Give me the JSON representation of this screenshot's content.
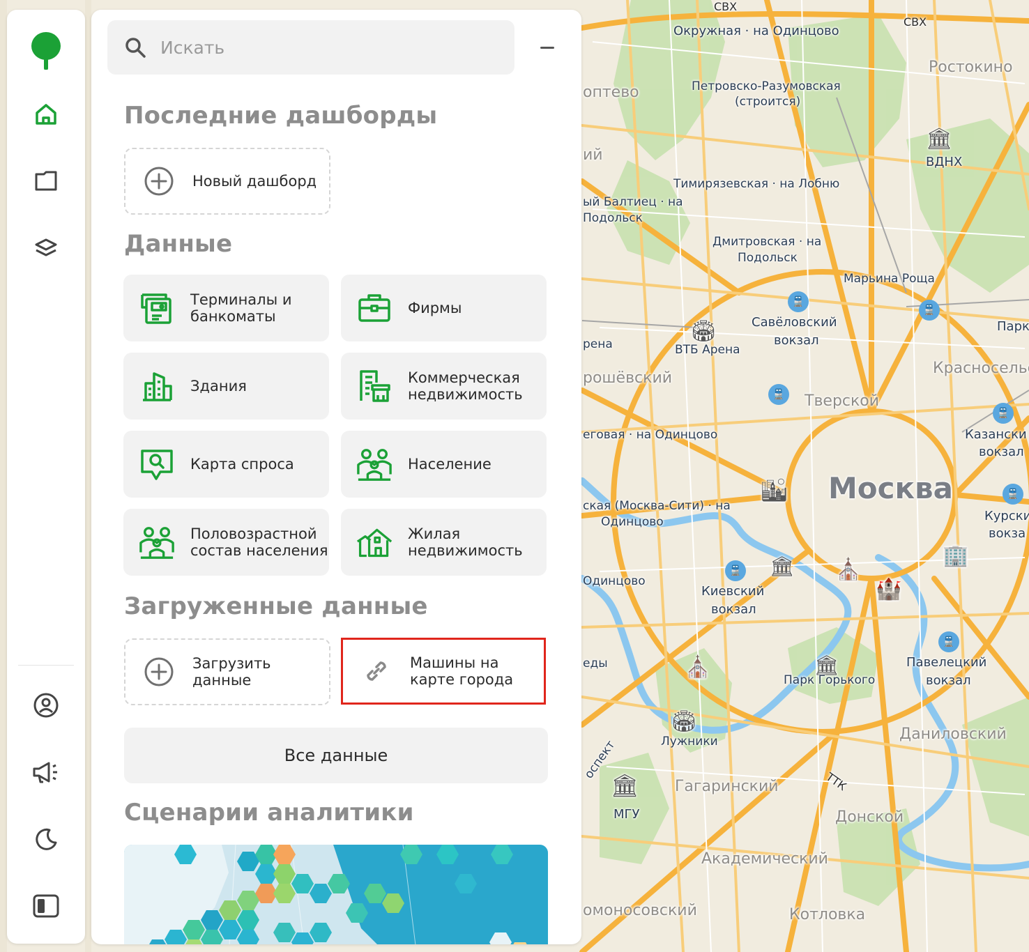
{
  "map": {
    "labels": {
      "svh_top": "СВХ",
      "svh_right": "СВХ",
      "okruzhnaya": "Окружная · на Одинцово",
      "rostokino": "Ростокино",
      "koptevo": "оптево",
      "petrovsko": "Петровско-Разумовская",
      "stroitsya": "(строится)",
      "vdnh": "ВДНХ",
      "iy": "ий",
      "timiryazevskaya": "Тимирязевская · на Лобню",
      "baltiets": "ый Балтиец · на",
      "podolsk1": "Подольск",
      "dmitrovskaya": "Дмитровская · на",
      "podolsk2": "Подольск",
      "maryina": "Марьина Роща",
      "savelovsky": "Савёловский",
      "vokzal1": "вокзал",
      "park": "Парк",
      "rena": "рена",
      "vtb": "ВТБ Арена",
      "krasnoselsky": "Красносельс",
      "roshevsky": "рошёвский",
      "tverskoy": "Тверской",
      "begovaya": "еговая · на Одинцово",
      "kazansky": "Казански",
      "vokzal2": "вокзал",
      "moskva": "Москва",
      "moskvacity": "ская (Москва-Сити) · на",
      "odintsovo1": "Одинцово",
      "kursky": "Курски",
      "vokzal3": "вокза",
      "odintsovo2": "Одинцово",
      "kievsky": "Киевский",
      "vokzal4": "вокзал",
      "edy": "еды",
      "park_gorkogo": "Парк Горького",
      "paveletsky": "Павелецкий",
      "vokzal5": "вокзал",
      "luzhniki": "Лужники",
      "danilovsky": "Даниловский",
      "prospekt": "оспект",
      "ttk": "ТТК",
      "gagarinsky": "Гагаринский",
      "mgu": "МГУ",
      "donskoy": "Донской",
      "akademichesky": "Академический",
      "lomonosovsky": "омоносовский",
      "kotlovka": "Котловка"
    }
  },
  "rail": {
    "items": [
      {
        "name": "logo",
        "icon": "tree-logo-icon"
      },
      {
        "name": "home",
        "icon": "home-icon"
      },
      {
        "name": "folder",
        "icon": "folder-icon"
      },
      {
        "name": "layers",
        "icon": "layers-icon"
      },
      {
        "name": "profile",
        "icon": "user-circle-icon"
      },
      {
        "name": "announcements",
        "icon": "megaphone-icon"
      },
      {
        "name": "theme",
        "icon": "moon-icon"
      },
      {
        "name": "sidebar",
        "icon": "sidebar-toggle-icon"
      }
    ]
  },
  "panel": {
    "search": {
      "placeholder": "Искать"
    },
    "recent_dashboards": {
      "title": "Последние дашборды",
      "new_dashboard": "Новый дашборд"
    },
    "data": {
      "title": "Данные",
      "tiles": [
        {
          "label": "Терминалы и банкоматы",
          "icon": "atm-icon"
        },
        {
          "label": "Фирмы",
          "icon": "briefcase-icon"
        },
        {
          "label": "Здания",
          "icon": "buildings-icon"
        },
        {
          "label": "Коммерческая недвижимость",
          "icon": "commercial-property-icon"
        },
        {
          "label": "Карта спроса",
          "icon": "search-demand-icon"
        },
        {
          "label": "Население",
          "icon": "population-icon"
        },
        {
          "label": "Половозрастной состав населения",
          "icon": "age-sex-icon"
        },
        {
          "label": "Жилая недвижимость",
          "icon": "residential-icon"
        }
      ]
    },
    "uploaded": {
      "title": "Загруженные данные",
      "upload": "Загрузить данные",
      "cars": "Машины на карте города"
    },
    "all_data": "Все данные",
    "scenarios": {
      "title": "Сценарии аналитики"
    }
  },
  "colors": {
    "brand_green": "#1ba136",
    "highlight_red": "#e0261c",
    "tile_bg": "#f2f2f2"
  }
}
